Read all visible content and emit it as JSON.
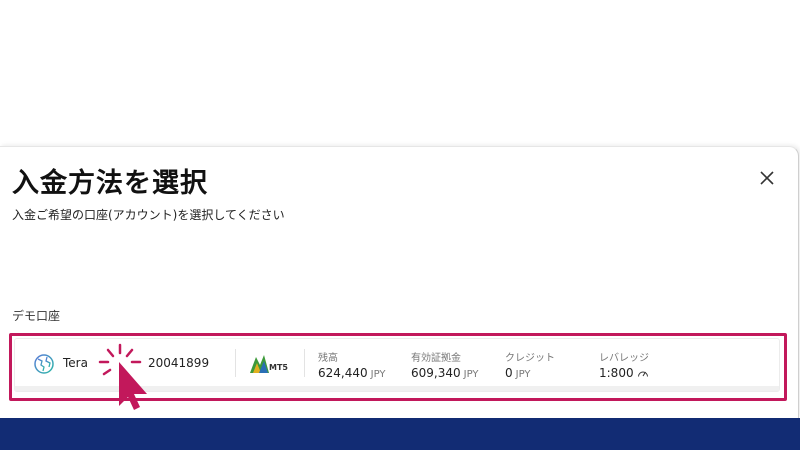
{
  "modal": {
    "title": "入金方法を選択",
    "subtitle": "入金ご希望の口座(アカウント)を選択してください",
    "close_icon": "close-icon"
  },
  "section": {
    "label": "デモ口座"
  },
  "account": {
    "platform_icon": "globe-icon",
    "platform_name": "Tera",
    "number": "20041899",
    "terminal_logo": "mt5-logo",
    "terminal_logo_text": "MT5",
    "balance": {
      "label": "残高",
      "value": "624,440",
      "unit": "JPY"
    },
    "margin": {
      "label": "有効証拠金",
      "value": "609,340",
      "unit": "JPY"
    },
    "credit": {
      "label": "クレジット",
      "value": "0",
      "unit": "JPY"
    },
    "leverage": {
      "label": "レバレッジ",
      "value": "1:800",
      "icon": "gauge-icon"
    }
  },
  "colors": {
    "highlight": "#c2185b",
    "footer": "#122c74",
    "cursor": "#c2185b"
  },
  "overlay": {
    "cursor_icon": "pointer-cursor-icon"
  }
}
